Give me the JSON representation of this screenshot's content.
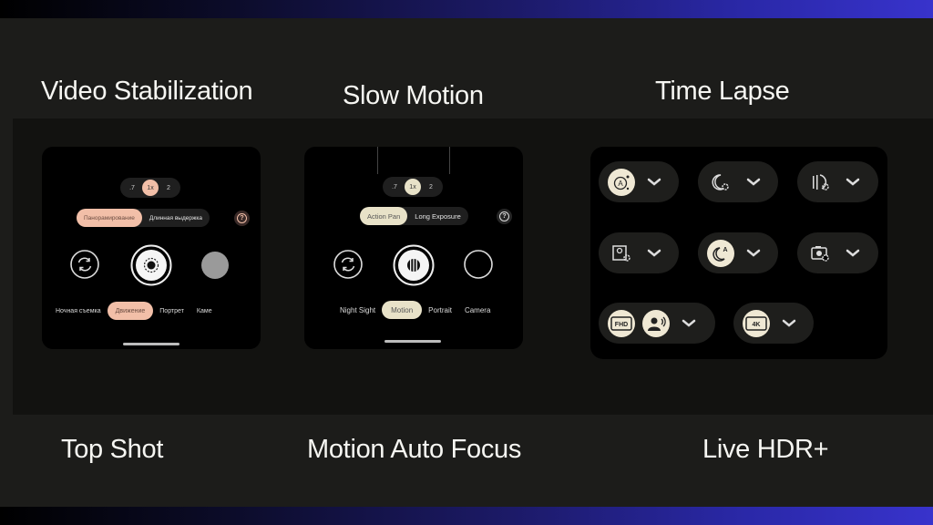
{
  "colors": {
    "band_gradient": [
      "#000000",
      "#3833cc"
    ],
    "accent_peach": "#f2bfa8",
    "accent_cream": "#e8e2c8",
    "icon_fill": "#efe8d4"
  },
  "titles": {
    "video_stabilization": "Video Stabilization",
    "slow_motion": "Slow Motion",
    "time_lapse": "Time Lapse",
    "top_shot": "Top Shot",
    "motion_auto_focus": "Motion Auto Focus",
    "live_hdr": "Live HDR+"
  },
  "phone_ru": {
    "zoom_levels": [
      ".7",
      "1x",
      "2"
    ],
    "zoom_selected": "1x",
    "submodes": [
      "Панорамирование",
      "Длинная выдержка"
    ],
    "submode_selected": "Панорамирование",
    "help_icon": "?",
    "modes": [
      "Ночная съемка",
      "Движение",
      "Портрет",
      "Каме"
    ],
    "mode_selected": "Движение"
  },
  "phone_en": {
    "zoom_levels": [
      ".7",
      "1x",
      "2"
    ],
    "zoom_selected": "1x",
    "submodes": [
      "Action Pan",
      "Long Exposure"
    ],
    "submode_selected": "Action Pan",
    "help_icon": "?",
    "modes": [
      "Night Sight",
      "Motion",
      "Portrait",
      "Camera"
    ],
    "mode_selected": "Motion"
  },
  "settings_pills": [
    {
      "icons": [
        "auto-enhance-icon"
      ],
      "filled": [
        true
      ]
    },
    {
      "icons": [
        "night-settings-icon"
      ],
      "filled": [
        false
      ]
    },
    {
      "icons": [
        "motion-settings-icon"
      ],
      "filled": [
        false
      ]
    },
    {
      "icons": [
        "portrait-settings-icon"
      ],
      "filled": [
        false
      ]
    },
    {
      "icons": [
        "night-auto-icon"
      ],
      "filled": [
        true
      ]
    },
    {
      "icons": [
        "camera-settings-icon"
      ],
      "filled": [
        false
      ]
    },
    {
      "icons": [
        "fhd-icon",
        "speech-enhance-icon"
      ],
      "labels": [
        "FHD"
      ],
      "filled": [
        true,
        true
      ]
    },
    {
      "icons": [
        "4k-icon"
      ],
      "labels": [
        "4K"
      ],
      "filled": [
        true
      ]
    }
  ]
}
